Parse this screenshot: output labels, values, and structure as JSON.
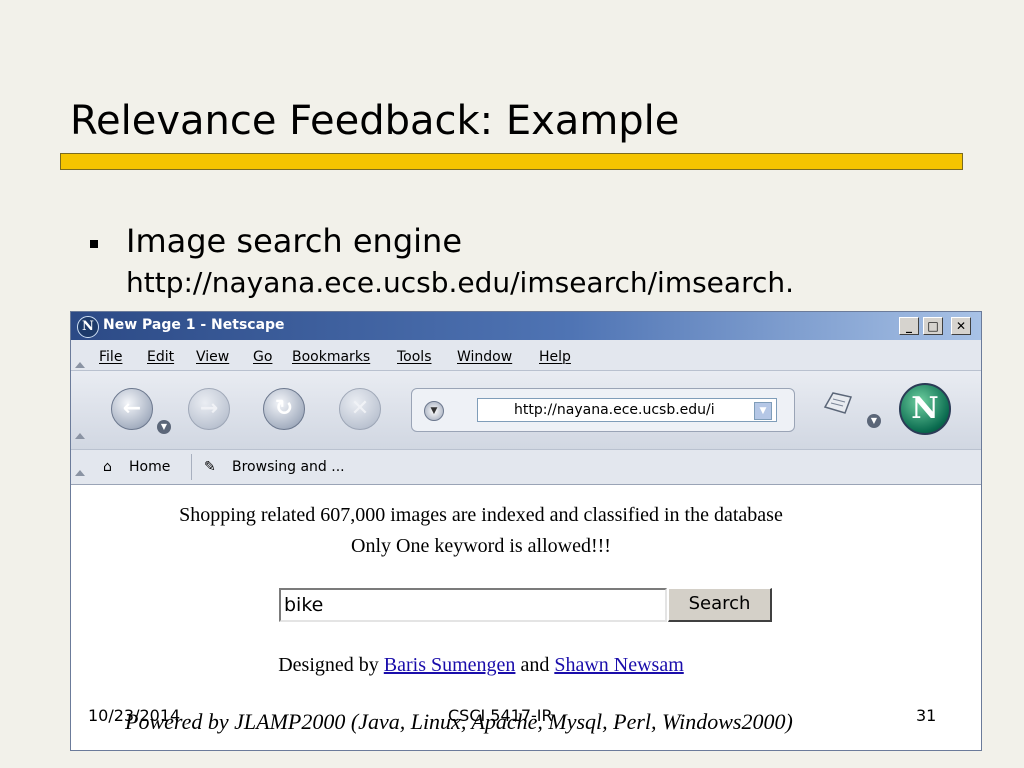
{
  "slide": {
    "title": "Relevance Feedback: Example",
    "bullet": "Image search engine",
    "bullet_url": "http://nayana.ece.ucsb.edu/imsearch/imsearch."
  },
  "browser": {
    "window_title": "New Page 1 - Netscape",
    "controls": {
      "minimize": "_",
      "maximize": "□",
      "close": "✕"
    },
    "menu": [
      "File",
      "Edit",
      "View",
      "Go",
      "Bookmarks",
      "Tools",
      "Window",
      "Help"
    ],
    "nav_icons": [
      "back-icon",
      "forward-icon",
      "reload-icon",
      "stop-icon"
    ],
    "address": "http://nayana.ece.ucsb.edu/i",
    "personal_bar": {
      "home": "Home",
      "bookmark": "Browsing and ..."
    }
  },
  "page": {
    "line1": "Shopping related 607,000 images are indexed and classified in the database",
    "line2": "Only One keyword is allowed!!!",
    "search_value": "bike",
    "search_button": "Search",
    "designed_prefix": "Designed by",
    "author1": "Baris Sumengen",
    "designed_and": "and",
    "author2": "Shawn Newsam",
    "powered": "Powered by JLAMP2000 (Java, Linux, Apache, Mysql, Perl, Windows2000)"
  },
  "footer": {
    "date": "10/23/2014",
    "course": "CSCI 5417-IR",
    "page_number": "31"
  },
  "colors": {
    "title_bar_accent": "#f5c400",
    "link": "#1a0dab",
    "window_title_bg": "#2c4a86"
  }
}
